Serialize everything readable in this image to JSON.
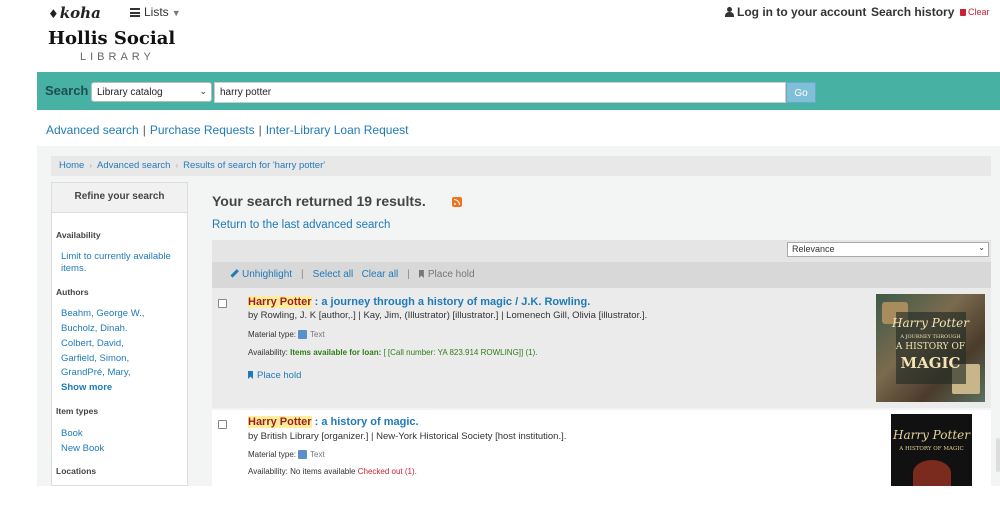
{
  "topbar": {
    "logo": "koha",
    "lists_label": "Lists",
    "login_label": "Log in to your account",
    "search_history_label": "Search history",
    "clear_label": "Clear",
    "library_name": "Hollis Social",
    "library_subtitle": "LIBRARY"
  },
  "search": {
    "label": "Search",
    "scope_selected": "Library catalog",
    "query": "harry potter",
    "go_label": "Go"
  },
  "more_searches": [
    "Advanced search",
    "Purchase Requests",
    "Inter-Library Loan Request"
  ],
  "breadcrumb": [
    "Home",
    "Advanced search",
    "Results of search for 'harry potter'"
  ],
  "refine": {
    "title": "Refine your search",
    "availability_heading": "Availability",
    "availability_link": "Limit to currently available items.",
    "authors_heading": "Authors",
    "authors": [
      "Beahm, George W.,",
      "Bucholz, Dinah.",
      "Colbert, David,",
      "Garfield, Simon,",
      "GrandPré, Mary,"
    ],
    "show_more": "Show more",
    "item_types_heading": "Item types",
    "item_types": [
      "Book",
      "New Book"
    ],
    "locations_heading": "Locations"
  },
  "results": {
    "summary": "Your search returned 19 results.",
    "return_link": "Return to the last advanced search",
    "sort_selected": "Relevance",
    "toolbar": {
      "unhighlight": "Unhighlight",
      "select_all": "Select all",
      "clear_all": "Clear all",
      "place_hold": "Place hold"
    },
    "items": [
      {
        "title_highlight": "Harry Potter",
        "title_rest": " : a journey through a history of magic / J.K. Rowling.",
        "authors": "by Rowling, J. K [author,.] | Kay, Jim, (Illustrator) [illustrator.] | Lomenech Gill, Olivia [illustrator.].",
        "material_label": "Material type:",
        "material_value": "Text",
        "availability_label": "Availability:",
        "availability_status": "Items available for loan:",
        "availability_detail": "[ [Call number: YA 823.914 ROWLING]] (1).",
        "place_hold": "Place hold",
        "cover_title_1": "Harry Potter",
        "cover_title_2": "A JOURNEY THROUGH",
        "cover_title_3": "A HISTORY OF",
        "cover_title_4": "MAGIC"
      },
      {
        "title_highlight": "Harry Potter",
        "title_rest": " : a history of magic.",
        "authors": "by British Library [organizer.] | New-York Historical Society [host institution.].",
        "material_label": "Material type:",
        "material_value": "Text",
        "availability_label": "Availability:",
        "availability_status": "No items available",
        "availability_detail": "Checked out (1).",
        "cover_title_1": "Harry Potter",
        "cover_title_2": "A HISTORY OF MAGIC"
      }
    ]
  },
  "colors": {
    "search_bar": "#47b1a4",
    "link": "#1f7ab8",
    "available": "#2e7d16",
    "checked_out": "#c82333",
    "highlight": "#ffed9c"
  }
}
